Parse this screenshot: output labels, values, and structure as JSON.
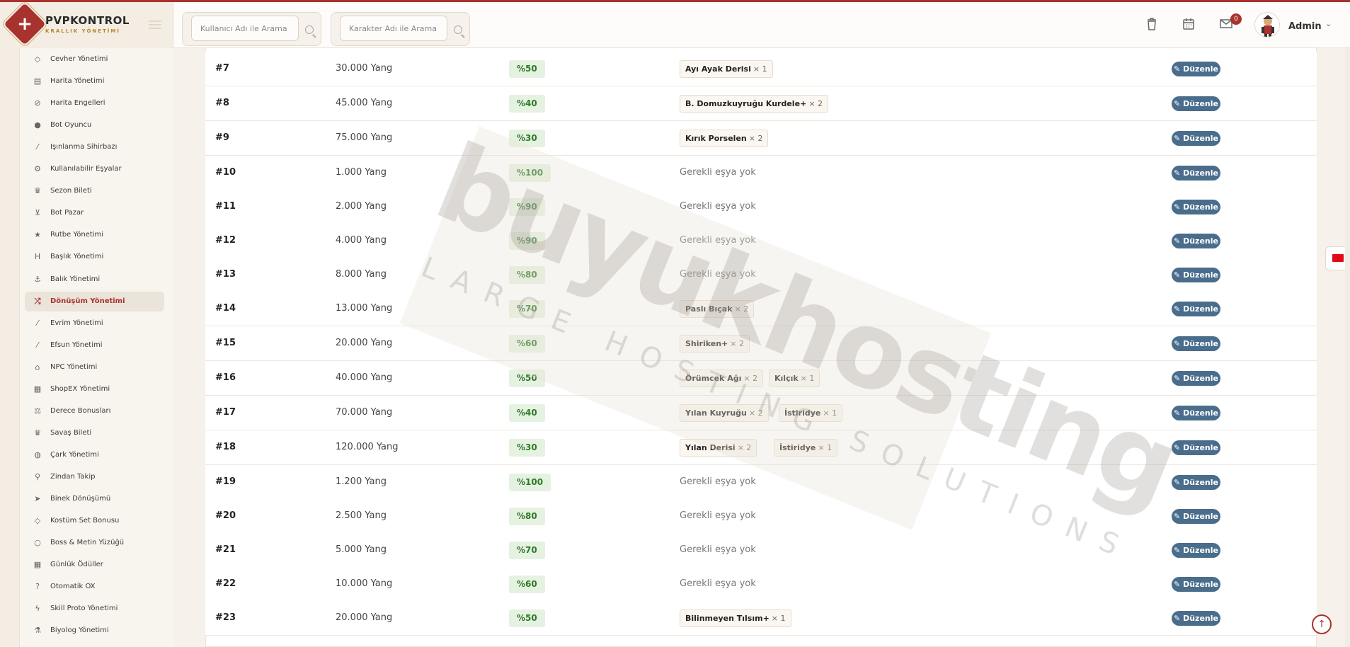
{
  "brand": {
    "title": "PVPKONTROL",
    "subtitle": "KRALLIK YÖNETİMİ"
  },
  "search": {
    "user_placeholder": "Kullanıcı Adı ile Arama",
    "char_placeholder": "Karakter Adı ile Arama"
  },
  "header": {
    "notif_count": "0",
    "admin_name": "Admin",
    "icons": [
      "trash-icon",
      "calendar-icon",
      "mail-icon",
      "user-avatar",
      "chevron-down-icon"
    ]
  },
  "sidebar": {
    "items": [
      {
        "label": "Cevher Yönetimi",
        "icon": "gem-icon"
      },
      {
        "label": "Harita Yönetimi",
        "icon": "map-icon"
      },
      {
        "label": "Harita Engelleri",
        "icon": "ban-icon"
      },
      {
        "label": "Bot Oyuncu",
        "icon": "android-icon"
      },
      {
        "label": "Işınlanma Sihirbazı",
        "icon": "wand-icon"
      },
      {
        "label": "Kullanılabilir Eşyalar",
        "icon": "gears-icon"
      },
      {
        "label": "Sezon Bileti",
        "icon": "trophy-icon"
      },
      {
        "label": "Bot Pazar",
        "icon": "cart-icon"
      },
      {
        "label": "Rutbe Yönetimi",
        "icon": "star-icon"
      },
      {
        "label": "Başlık Yönetimi",
        "icon": "heading-icon"
      },
      {
        "label": "Balık Yönetimi",
        "icon": "anchor-icon"
      },
      {
        "label": "Dönüşüm Yönetimi",
        "icon": "shuffle-icon",
        "active": true
      },
      {
        "label": "Evrim Yönetimi",
        "icon": "wand-icon"
      },
      {
        "label": "Efsun Yönetimi",
        "icon": "wand-icon"
      },
      {
        "label": "NPC Yönetimi",
        "icon": "bank-icon"
      },
      {
        "label": "ShopEX Yönetimi",
        "icon": "shop-icon"
      },
      {
        "label": "Derece Bonusları",
        "icon": "scale-icon"
      },
      {
        "label": "Savaş Bileti",
        "icon": "trophy-icon"
      },
      {
        "label": "Çark Yönetimi",
        "icon": "globe-icon"
      },
      {
        "label": "Zindan Takip",
        "icon": "map-pin-icon"
      },
      {
        "label": "Binek Dönüşümü",
        "icon": "rocket-icon"
      },
      {
        "label": "Kostüm Set Bonusu",
        "icon": "gem-icon"
      },
      {
        "label": "Boss & Metin Yüzüğü",
        "icon": "circle-icon"
      },
      {
        "label": "Günlük Ödüller",
        "icon": "calendar-icon"
      },
      {
        "label": "Otomatik OX",
        "icon": "question-icon"
      },
      {
        "label": "Skill Proto Yönetimi",
        "icon": "bolt-icon"
      },
      {
        "label": "Biyolog Yönetimi",
        "icon": "flask-icon"
      }
    ]
  },
  "table": {
    "edit_label": "Düzenle",
    "none_label": "Gerekli eşya yok",
    "rows": [
      {
        "id": "#7",
        "yang": "30.000 Yang",
        "pct": "%50",
        "items": [
          {
            "name": "Ayı Ayak Derisi",
            "qty": "× 1"
          }
        ]
      },
      {
        "id": "#8",
        "yang": "45.000 Yang",
        "pct": "%40",
        "items": [
          {
            "name": "B. Domuzkuyruğu Kurdele+",
            "qty": "× 2"
          }
        ]
      },
      {
        "id": "#9",
        "yang": "75.000 Yang",
        "pct": "%30",
        "items": [
          {
            "name": "Kırık Porselen",
            "qty": "× 2"
          }
        ]
      },
      {
        "id": "#10",
        "yang": "1.000 Yang",
        "pct": "%100",
        "items": []
      },
      {
        "id": "#11",
        "yang": "2.000 Yang",
        "pct": "%90",
        "items": []
      },
      {
        "id": "#12",
        "yang": "4.000 Yang",
        "pct": "%90",
        "items": []
      },
      {
        "id": "#13",
        "yang": "8.000 Yang",
        "pct": "%80",
        "items": []
      },
      {
        "id": "#14",
        "yang": "13.000 Yang",
        "pct": "%70",
        "items": [
          {
            "name": "Paslı Bıçak",
            "qty": "× 2"
          }
        ]
      },
      {
        "id": "#15",
        "yang": "20.000 Yang",
        "pct": "%60",
        "items": [
          {
            "name": "Shiriken+",
            "qty": "× 2"
          }
        ]
      },
      {
        "id": "#16",
        "yang": "40.000 Yang",
        "pct": "%50",
        "items": [
          {
            "name": "Örümcek Ağı",
            "qty": "× 2"
          },
          {
            "name": "Kılçık",
            "qty": "× 1"
          }
        ]
      },
      {
        "id": "#17",
        "yang": "70.000 Yang",
        "pct": "%40",
        "items": [
          {
            "name": "Yılan Kuyruğu",
            "qty": "× 2"
          },
          {
            "name": "İstiridye",
            "qty": "× 1"
          }
        ]
      },
      {
        "id": "#18",
        "yang": "120.000 Yang",
        "pct": "%30",
        "items": [
          {
            "name": "Yılan Derisi",
            "qty": "× 2"
          },
          {
            "name": "İstiridye",
            "qty": "× 1"
          }
        ]
      },
      {
        "id": "#19",
        "yang": "1.200 Yang",
        "pct": "%100",
        "items": []
      },
      {
        "id": "#20",
        "yang": "2.500 Yang",
        "pct": "%80",
        "items": []
      },
      {
        "id": "#21",
        "yang": "5.000 Yang",
        "pct": "%70",
        "items": []
      },
      {
        "id": "#22",
        "yang": "10.000 Yang",
        "pct": "%60",
        "items": []
      },
      {
        "id": "#23",
        "yang": "20.000 Yang",
        "pct": "%50",
        "items": [
          {
            "name": "Bilinmeyen Tılsım+",
            "qty": "× 1"
          }
        ]
      }
    ]
  },
  "watermark": {
    "big": "buyukhosting",
    "small": "LARGE HOSTING SOLUTIONS"
  },
  "colors": {
    "accent": "#a8322d",
    "edit_button": "#4a6d8c",
    "pct_bg": "#e6f2e1",
    "pct_text": "#2f7a2a"
  }
}
